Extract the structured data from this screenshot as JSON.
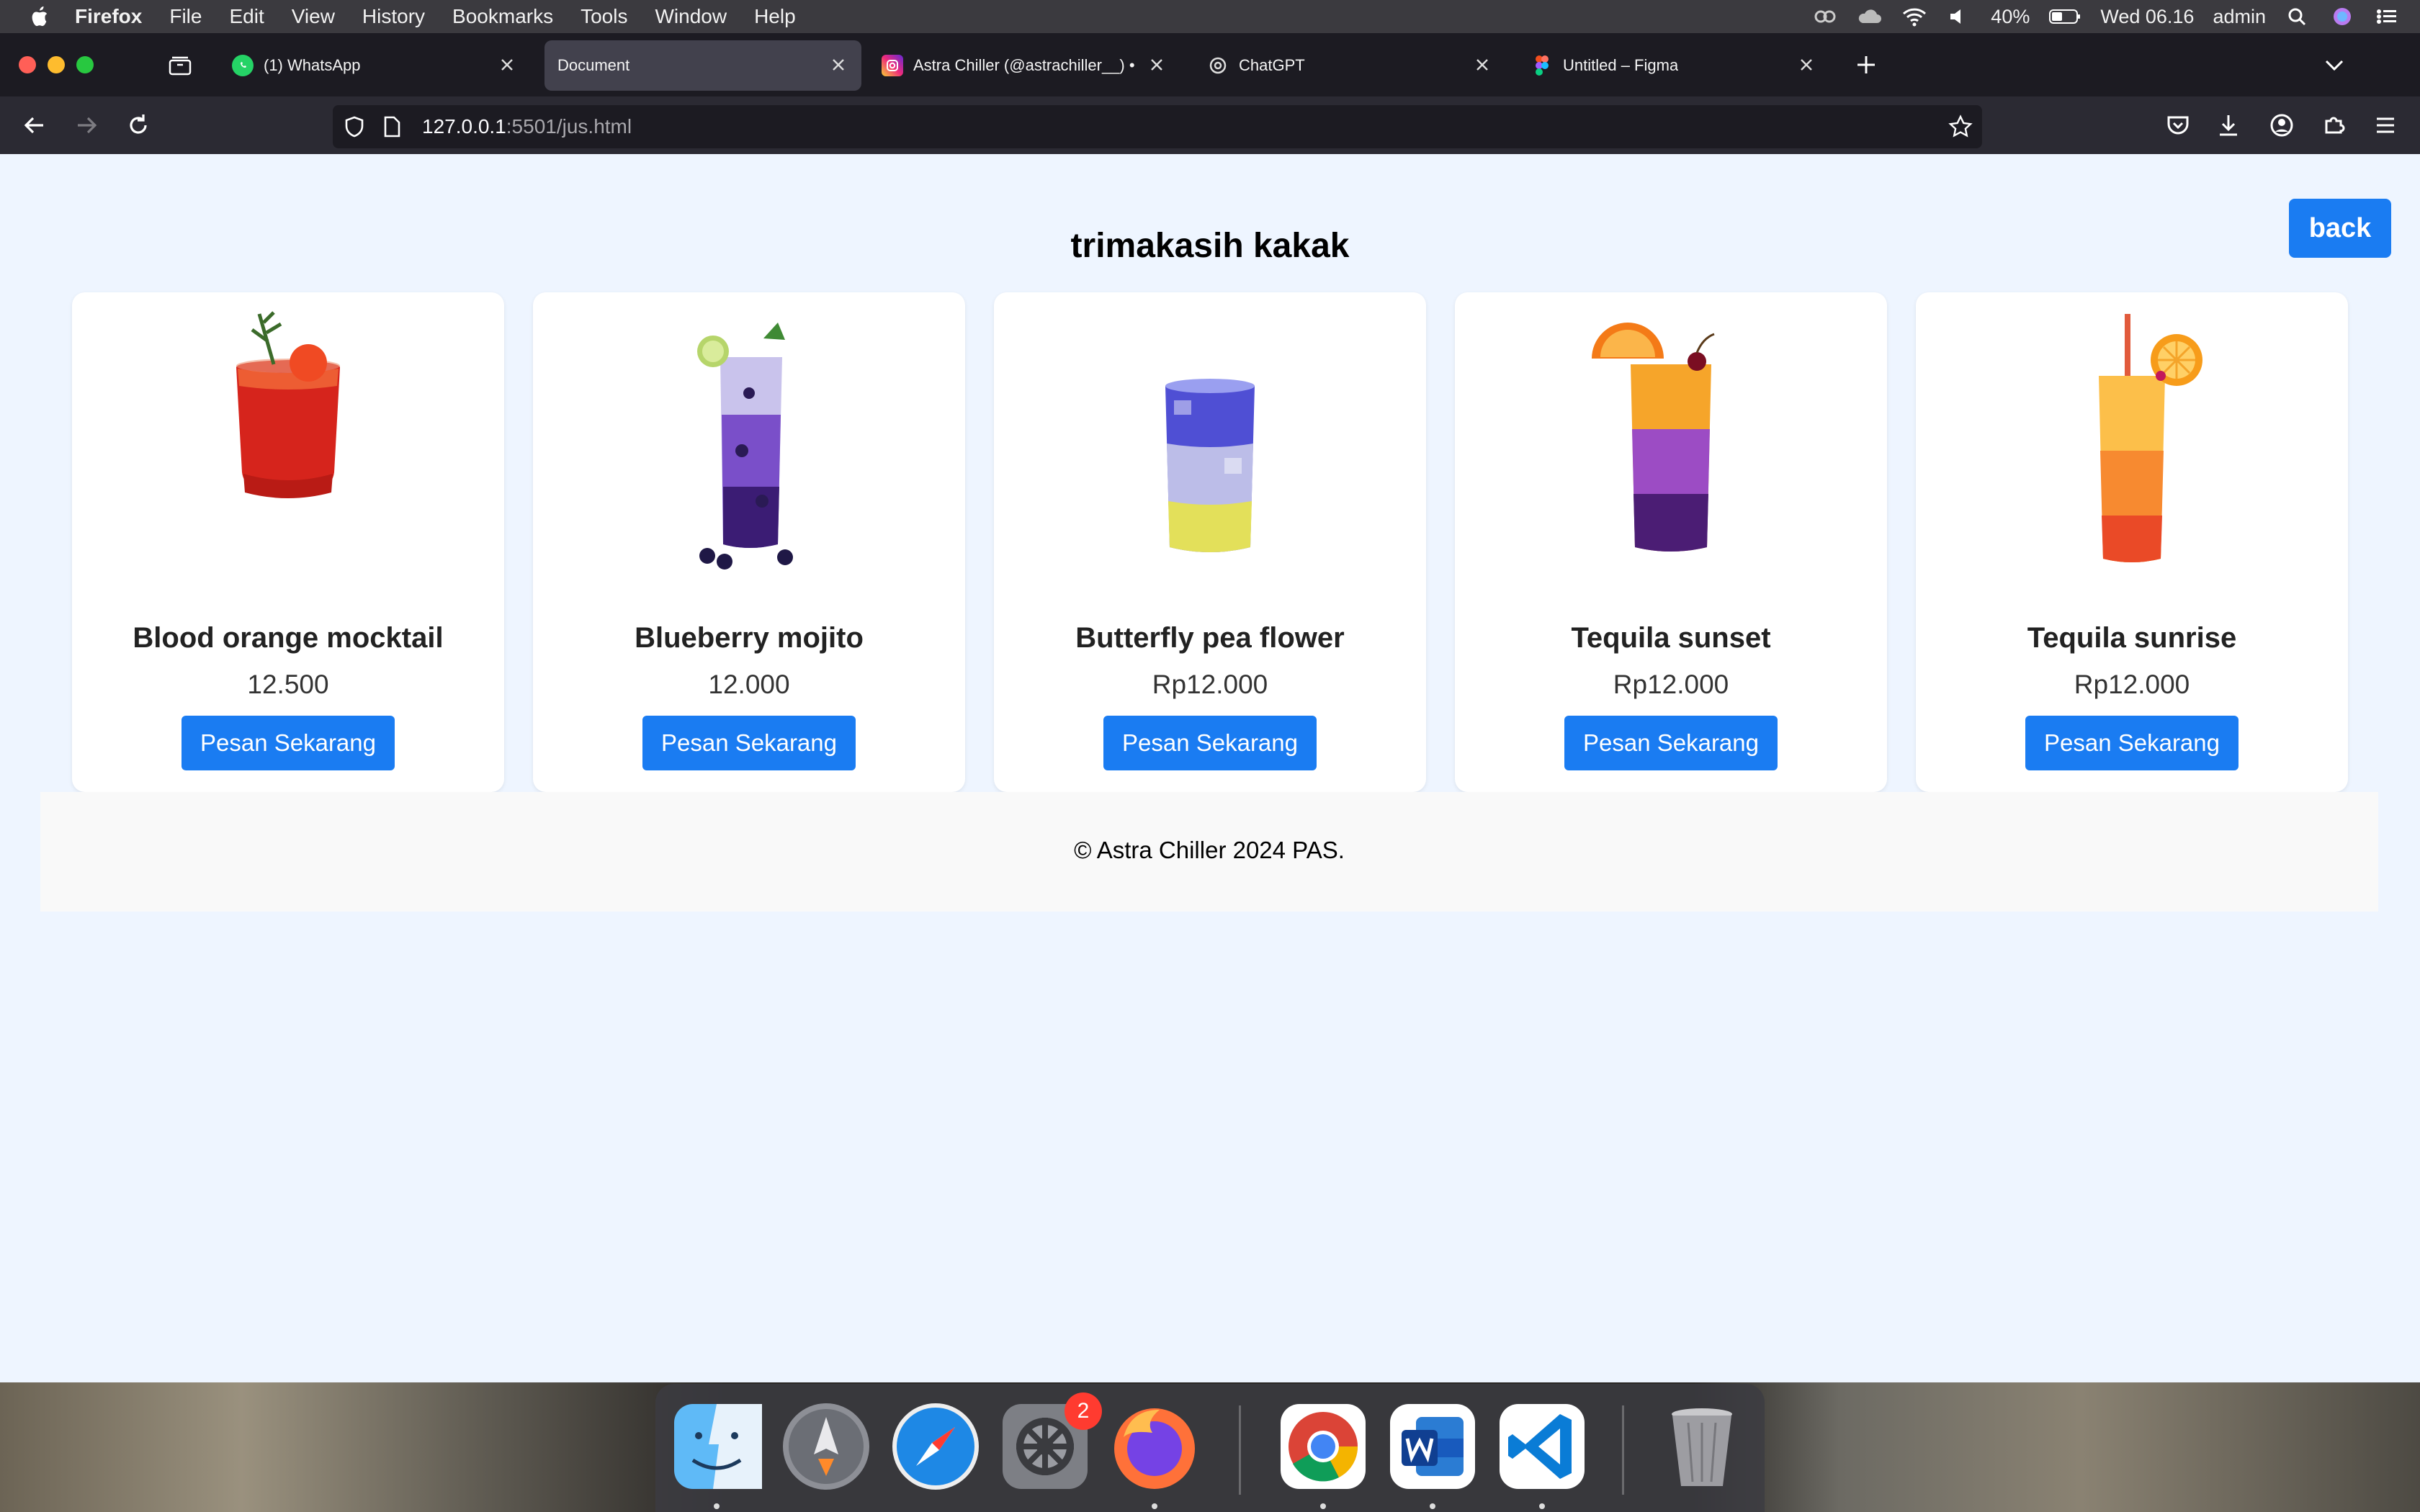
{
  "menubar": {
    "items": [
      "Firefox",
      "File",
      "Edit",
      "View",
      "History",
      "Bookmarks",
      "Tools",
      "Window",
      "Help"
    ],
    "battery_percent": "40%",
    "clock": "Wed 06.16",
    "user": "admin"
  },
  "tabs": [
    {
      "label": "(1) WhatsApp",
      "icon": "whatsapp-icon"
    },
    {
      "label": "Document",
      "icon": "none"
    },
    {
      "label": "Astra Chiller (@astrachiller__) •",
      "icon": "instagram-icon"
    },
    {
      "label": "ChatGPT",
      "icon": "chatgpt-icon"
    },
    {
      "label": "Untitled – Figma",
      "icon": "figma-icon"
    }
  ],
  "url": {
    "host": "127.0.0.1",
    "path": ":5501/jus.html"
  },
  "page": {
    "title": "trimakasih kakak",
    "back_label": "back",
    "products": [
      {
        "name": "Blood orange mocktail",
        "price": "12.500",
        "button": "Pesan Sekarang"
      },
      {
        "name": "Blueberry mojito",
        "price": "12.000",
        "button": "Pesan Sekarang"
      },
      {
        "name": "Butterfly pea flower",
        "price": "Rp12.000",
        "button": "Pesan Sekarang"
      },
      {
        "name": "Tequila sunset",
        "price": "Rp12.000",
        "button": "Pesan Sekarang"
      },
      {
        "name": "Tequila sunrise",
        "price": "Rp12.000",
        "button": "Pesan Sekarang"
      }
    ],
    "footer": "© Astra Chiller 2024 PAS."
  },
  "dock": {
    "apps": [
      "finder",
      "launchpad",
      "safari",
      "system-settings",
      "firefox",
      "chrome",
      "word",
      "vscode",
      "trash"
    ],
    "settings_badge": "2"
  },
  "colors": {
    "accent": "#1a7cf2",
    "page_bg": "#eef5ff"
  }
}
